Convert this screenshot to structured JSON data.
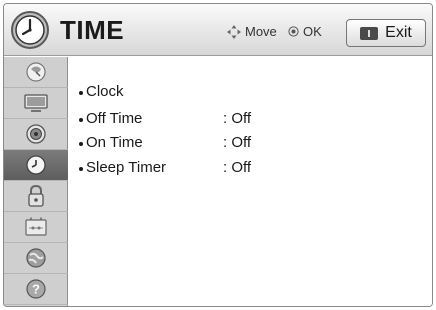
{
  "header": {
    "title": "TIME",
    "move_hint": "Move",
    "ok_hint": "OK",
    "exit_label": "Exit",
    "title_icon": "clock-icon"
  },
  "sidebar": {
    "items": [
      {
        "icon": "satellite-dish-icon",
        "active": false
      },
      {
        "icon": "monitor-icon",
        "active": false
      },
      {
        "icon": "speaker-icon",
        "active": false
      },
      {
        "icon": "clock-icon",
        "active": true
      },
      {
        "icon": "lock-icon",
        "active": false
      },
      {
        "icon": "settings-icon",
        "active": false
      },
      {
        "icon": "globe-icon",
        "active": false
      },
      {
        "icon": "help-icon",
        "active": false
      }
    ]
  },
  "menu": {
    "items": [
      {
        "label": "Clock",
        "value": ""
      },
      {
        "label": "Off Time",
        "value": ": Off"
      },
      {
        "label": "On Time",
        "value": ": Off"
      },
      {
        "label": "Sleep Timer",
        "value": ": Off"
      }
    ]
  },
  "colors": {
    "header_top": "#fafafa",
    "header_bottom": "#d7d7d7",
    "sidebar": "#cfcfcf",
    "sidebar_active": "#6a6a6a"
  }
}
